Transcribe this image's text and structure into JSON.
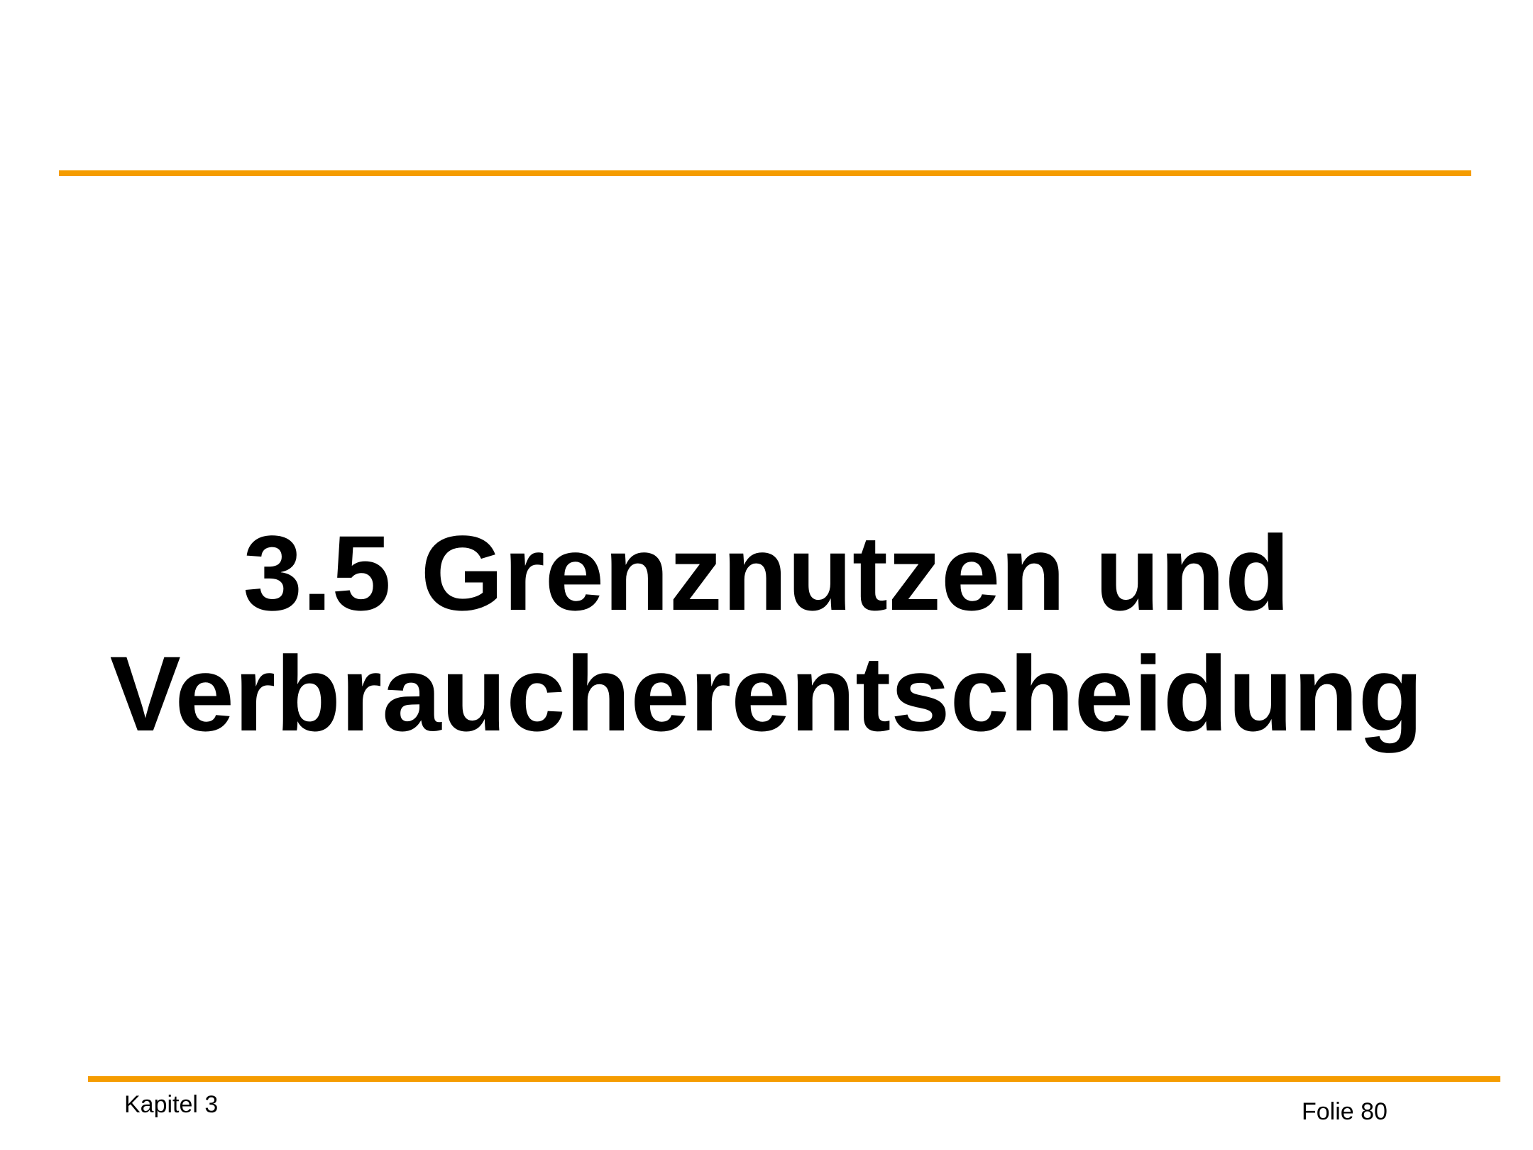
{
  "slide": {
    "title_line1": "3.5 Grenznutzen und",
    "title_line2": "Verbraucherentscheidung",
    "footer_left": "Kapitel 3",
    "footer_right": "Folie 80"
  },
  "colors": {
    "accent": "#f59c00",
    "background": "#ffffff",
    "text": "#000000"
  }
}
